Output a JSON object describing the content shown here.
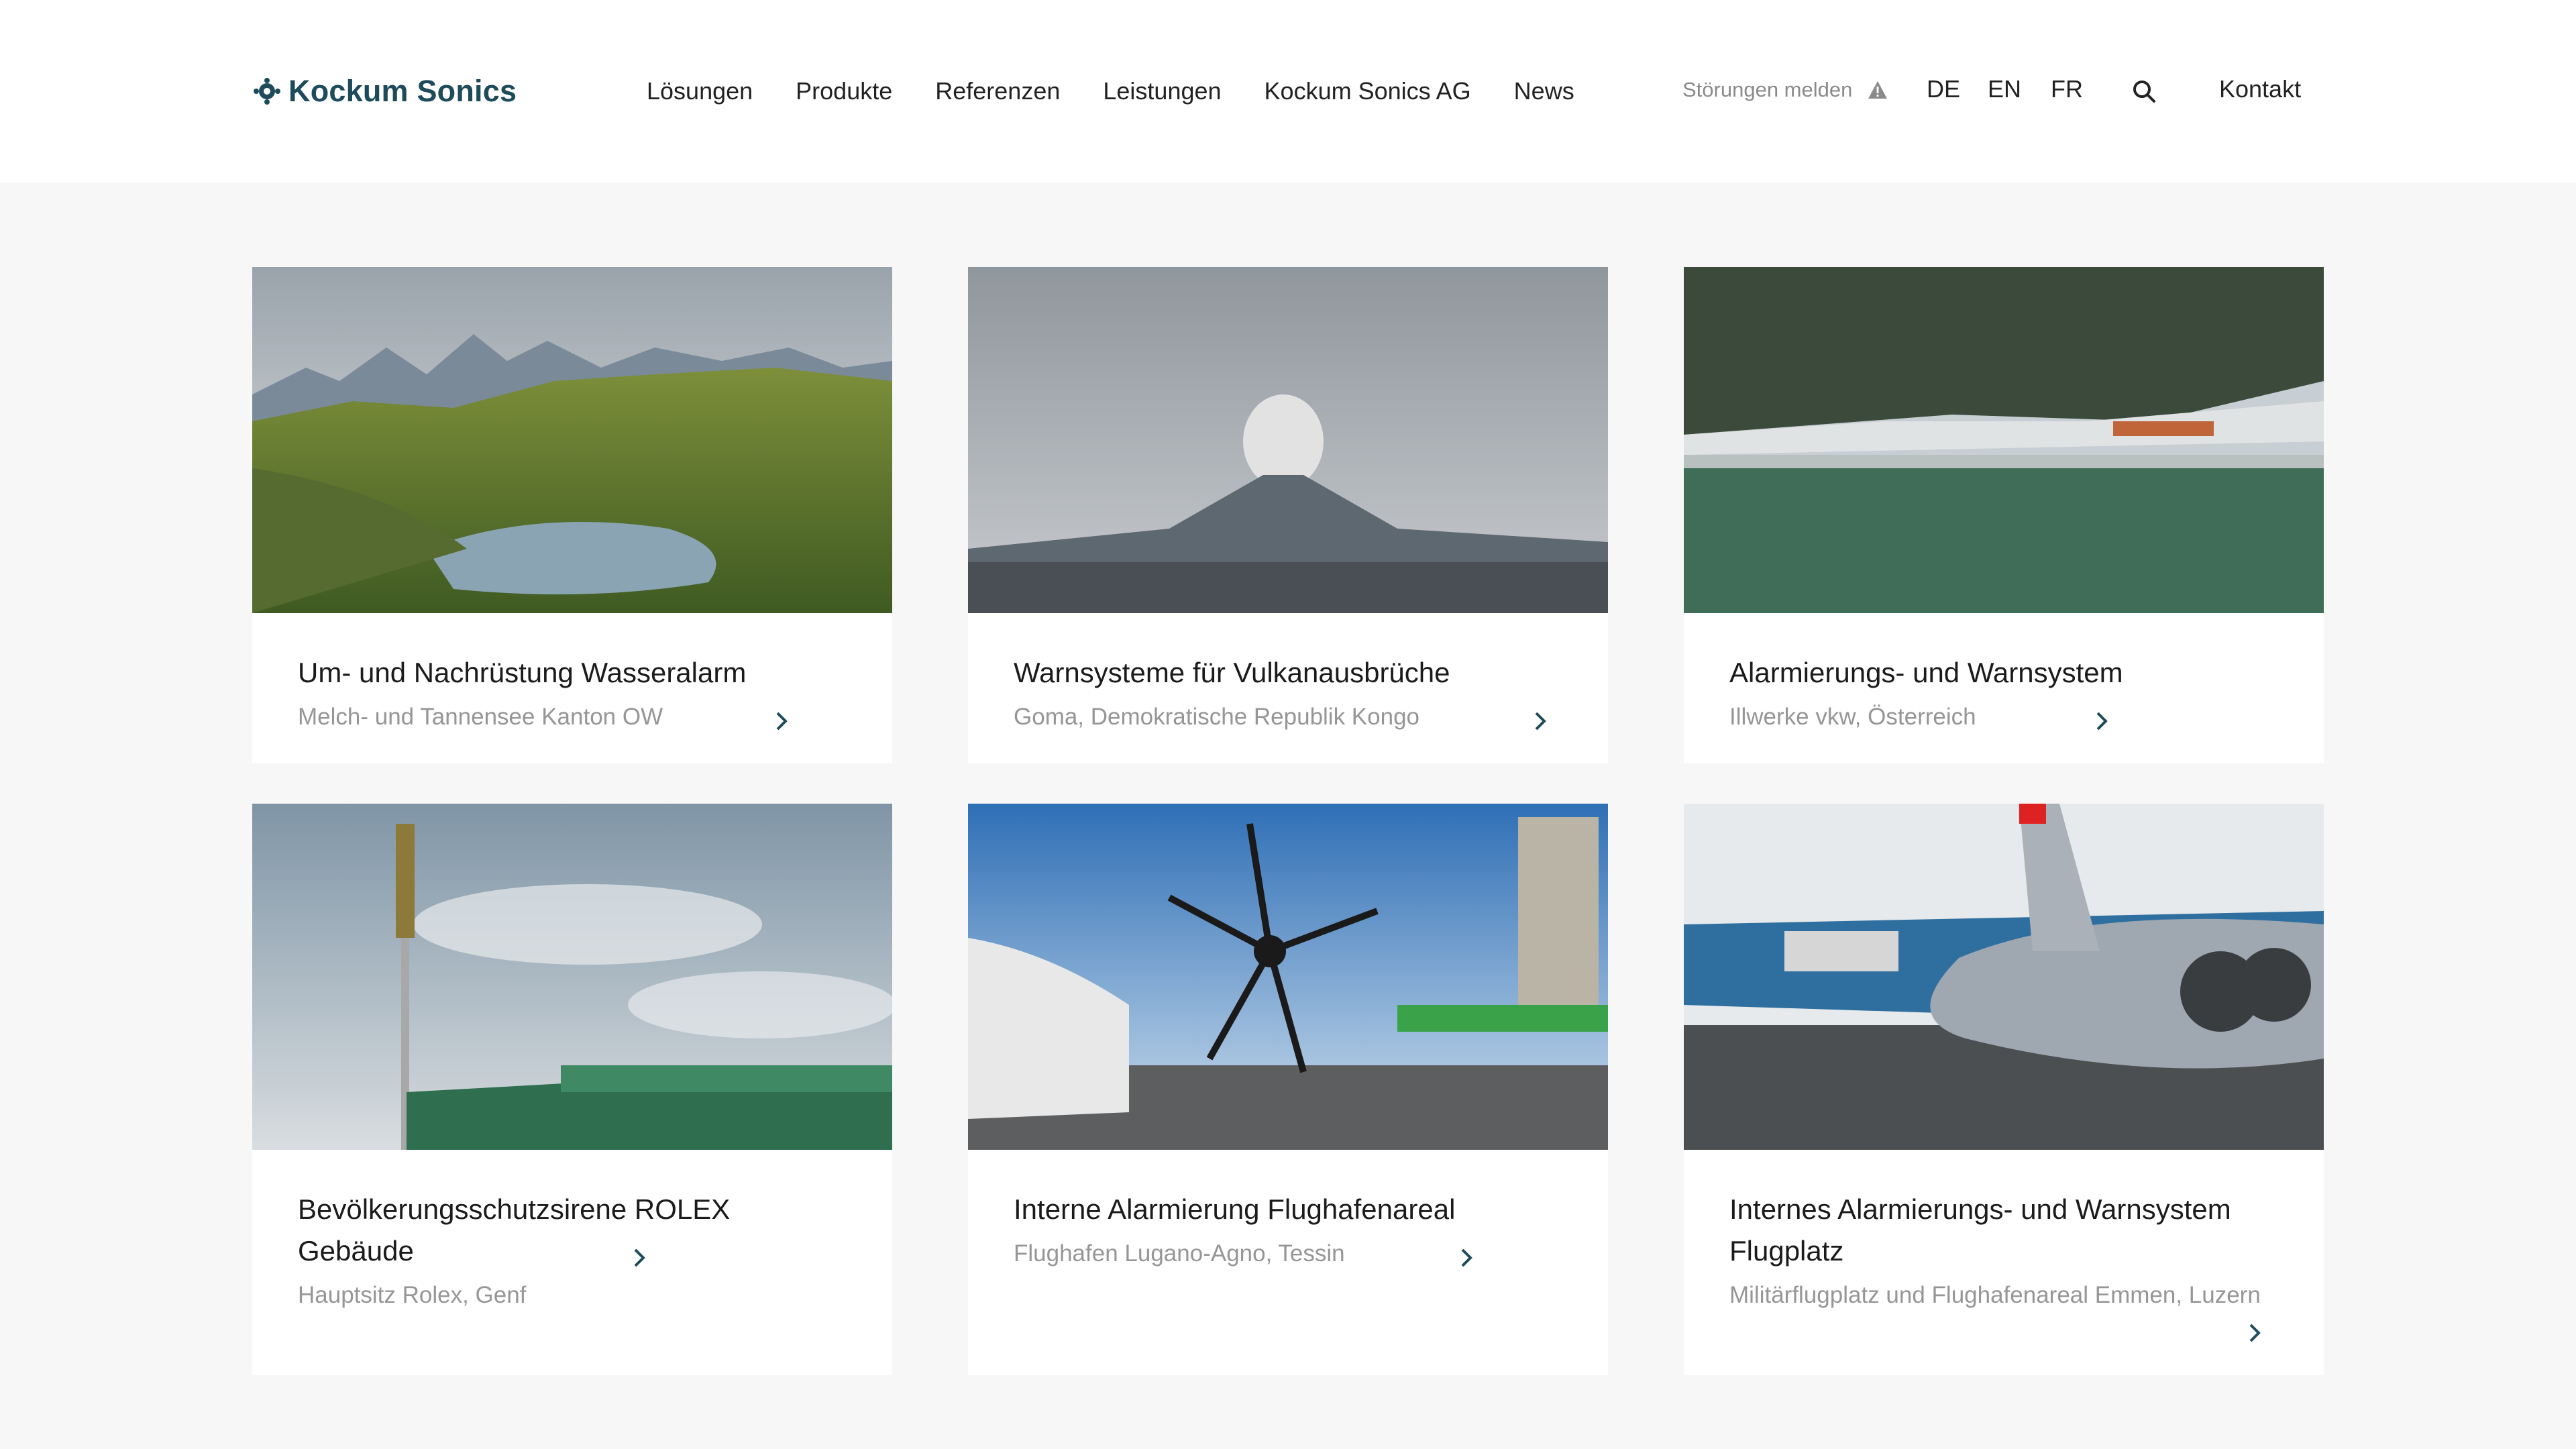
{
  "brand": {
    "name": "Kockum Sonics",
    "accent": "#1e4b5a"
  },
  "nav": [
    "Lösungen",
    "Produkte",
    "Referenzen",
    "Leistungen",
    "Kockum Sonics AG",
    "News"
  ],
  "utility": {
    "report": "Störungen melden",
    "report_icon": "warning-triangle-icon",
    "languages": [
      "DE",
      "EN",
      "FR"
    ],
    "search_icon": "search-icon",
    "contact": "Kontakt"
  },
  "cards": [
    {
      "title": "Um- und Nachrüstung Wasseralarm",
      "subtitle": "Melch- und Tannensee Kanton OW",
      "image": "alpine-lake-photo"
    },
    {
      "title": "Warnsysteme für Vulkanausbrüche",
      "subtitle": "Goma, Demokratische Republik Kongo",
      "image": "volcano-photo"
    },
    {
      "title": "Alarmierungs- und Warnsystem",
      "subtitle": "Illwerke vkw, Österreich",
      "image": "reservoir-village-photo"
    },
    {
      "title": "Bevölkerungsschutzsirene ROLEX Gebäude",
      "subtitle": "Hauptsitz Rolex, Genf",
      "image": "siren-building-photo"
    },
    {
      "title": "Interne Alarmierung Flughafenareal",
      "subtitle": "Flughafen Lugano-Agno, Tessin",
      "image": "propeller-plane-photo"
    },
    {
      "title": "Internes Alarmierungs- und Warnsystem Flugplatz",
      "subtitle": "Militärflugplatz und Flughafenareal Emmen, Luzern",
      "image": "fighter-jet-photo"
    }
  ]
}
